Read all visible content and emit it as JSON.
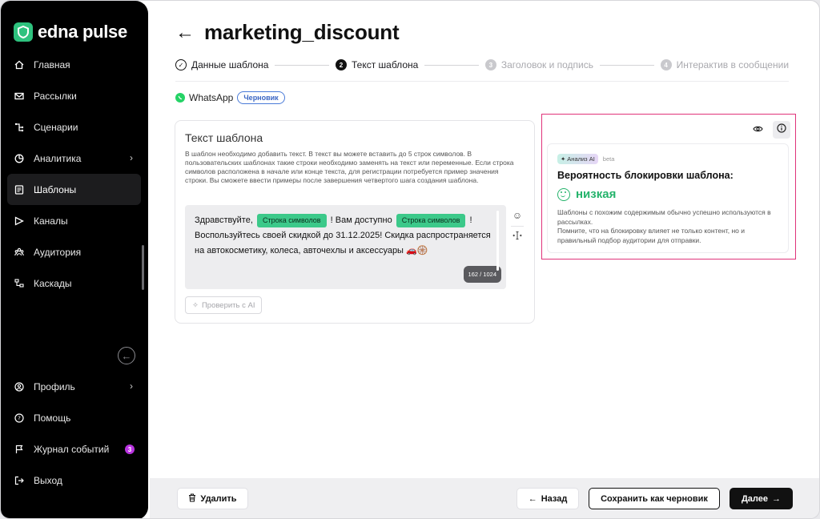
{
  "app": {
    "logo_text": "edna pulse"
  },
  "sidebar": {
    "items": [
      {
        "label": "Главная",
        "icon": "home-icon"
      },
      {
        "label": "Рассылки",
        "icon": "mail-icon"
      },
      {
        "label": "Сценарии",
        "icon": "flow-icon"
      },
      {
        "label": "Аналитика",
        "icon": "chart-icon",
        "has_submenu": true
      },
      {
        "label": "Шаблоны",
        "icon": "template-icon",
        "active": true
      },
      {
        "label": "Каналы",
        "icon": "send-icon"
      },
      {
        "label": "Аудитория",
        "icon": "audience-icon"
      },
      {
        "label": "Каскады",
        "icon": "cascade-icon"
      }
    ],
    "bottom_items": [
      {
        "label": "Профиль",
        "icon": "profile-icon",
        "has_submenu": true
      },
      {
        "label": "Помощь",
        "icon": "help-icon"
      },
      {
        "label": "Журнал событий",
        "icon": "flag-icon",
        "badge": "3"
      },
      {
        "label": "Выход",
        "icon": "logout-icon"
      }
    ]
  },
  "header": {
    "title": "marketing_discount"
  },
  "stepper": {
    "steps": [
      {
        "label": "Данные шаблона",
        "state": "done",
        "number": ""
      },
      {
        "label": "Текст шаблона",
        "state": "current",
        "number": "2"
      },
      {
        "label": "Заголовок и подпись",
        "state": "pending",
        "number": "3"
      },
      {
        "label": "Интерактив в сообщении",
        "state": "pending",
        "number": "4"
      }
    ]
  },
  "channel": {
    "name": "WhatsApp",
    "status": "Черновик"
  },
  "template_card": {
    "title": "Текст шаблона",
    "description": "В шаблон необходимо добавить текст. В текст вы можете вставить до 5 строк символов. В пользовательских шаблонах такие строки необходимо заменять на текст или переменные. Если строка символов расположена в начале или конце текста, для регистрации потребуется пример значения строки. Вы сможете ввести примеры после завершения четвертого шага создания шаблона.",
    "message": {
      "part1": "Здравствуйте,",
      "chip1": "Строка символов",
      "part2": "! Вам доступно",
      "chip2": "Строка символов",
      "part3": "!",
      "part4": "Воспользуйтесь своей скидкой до 31.12.2025! Скидка распространяется на автокосметику, колеса, авточехлы и аксессуары 🚗🛞"
    },
    "counter": "162 / 1024",
    "check_ai_label": "Проверить с AI"
  },
  "ai_panel": {
    "tag": "Анализ AI",
    "beta": "beta",
    "heading": "Вероятность блокировки шаблона:",
    "level": "низкая",
    "description_1": "Шаблоны с похожим содержимым обычно успешно используются в рассылках.",
    "description_2": "Помните, что на блокировку влияет не только контент, но и правильный подбор аудитории для отправки."
  },
  "footer": {
    "delete_label": "Удалить",
    "back_label": "Назад",
    "save_draft_label": "Сохранить как черновик",
    "next_label": "Далее"
  },
  "colors": {
    "accent_green": "#24b36b",
    "highlight_border": "#e0337a",
    "chip_green": "#3cc98a",
    "badge_purple": "#b933e0"
  }
}
